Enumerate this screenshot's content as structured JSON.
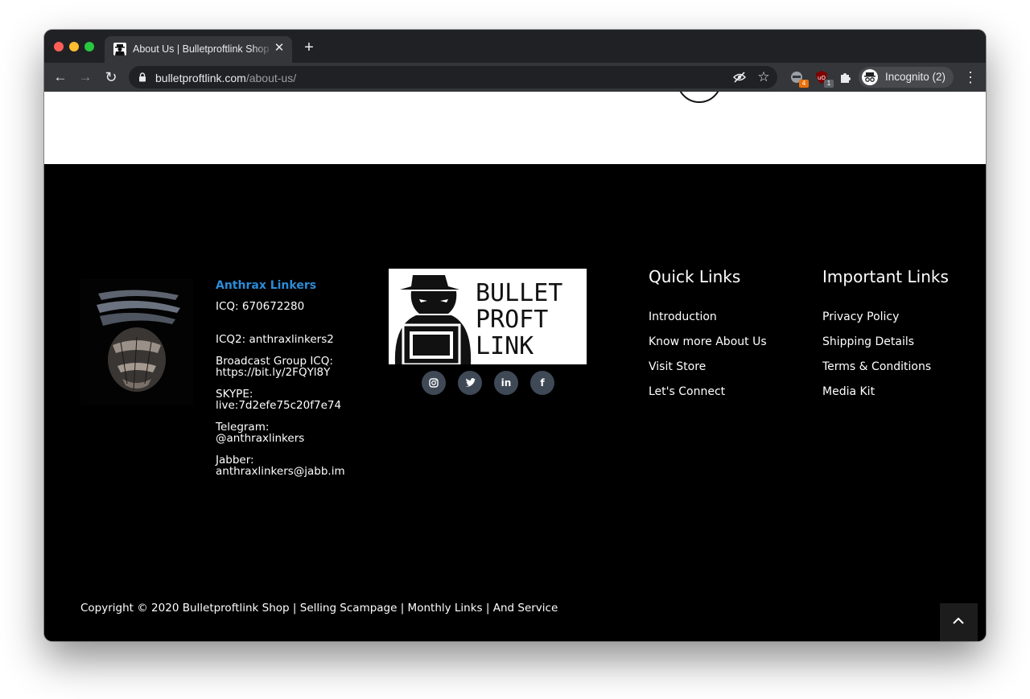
{
  "browser": {
    "tab": {
      "title": "About Us | Bulletproftlink Shop"
    },
    "url": {
      "host": "bulletproftlink.com",
      "path": "/about-us/"
    },
    "extensions": [
      {
        "name": "extension-1",
        "badge": "4",
        "badge_color": "#e8710a"
      },
      {
        "name": "ublock",
        "badge": "1",
        "badge_color": "#5f6368"
      }
    ],
    "profile": {
      "label": "Incognito (2)"
    }
  },
  "contact": {
    "name": "Anthrax Linkers",
    "lines": [
      "ICQ: 670672280",
      "ICQ2: anthraxlinkers2",
      "Broadcast Group ICQ:",
      "https://bit.ly/2FQYl8Y",
      "SKYPE:",
      "live:7d2efe75c20f7e74",
      "Telegram:",
      "@anthraxlinkers",
      "Jabber:",
      "anthraxlinkers@jabb.im"
    ]
  },
  "logo": {
    "lines": [
      "BULLET",
      "PROFT",
      "LINK"
    ]
  },
  "socials": [
    {
      "name": "instagram",
      "glyph": "◎"
    },
    {
      "name": "twitter",
      "glyph": "🐦"
    },
    {
      "name": "linkedin",
      "glyph": "in"
    },
    {
      "name": "facebook",
      "glyph": "f"
    }
  ],
  "quick_links": {
    "heading": "Quick Links",
    "items": [
      "Introduction",
      "Know more About Us",
      "Visit Store",
      "Let's Connect"
    ]
  },
  "important_links": {
    "heading": "Important Links",
    "items": [
      "Privacy Policy",
      "Shipping Details",
      "Terms & Conditions",
      "Media Kit"
    ]
  },
  "copyright": "Copyright © 2020 Bulletproftlink Shop | Selling Scampage | Monthly Links | And Service",
  "colors": {
    "accent": "#2a8cd8",
    "social_bg": "#3f4956",
    "footer_bg": "#000000"
  }
}
